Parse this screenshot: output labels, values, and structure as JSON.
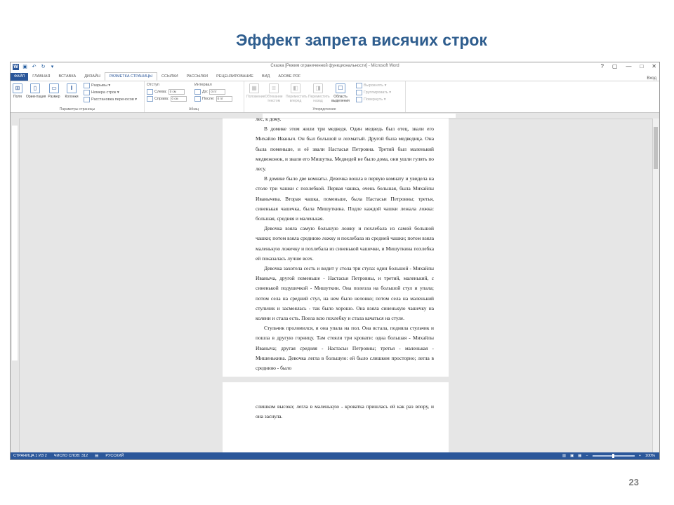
{
  "slide": {
    "title": "Эффект запрета висячих строк",
    "number": "23"
  },
  "window": {
    "doc_title": "Сказка [Режим ограниченной функциональности] - Microsoft Word",
    "help": "?",
    "restore": "▢",
    "minimize": "—",
    "maximize": "□",
    "close": "✕",
    "account": "Вход"
  },
  "tabs": [
    {
      "label": "ФАЙЛ"
    },
    {
      "label": "ГЛАВНАЯ"
    },
    {
      "label": "ВСТАВКА"
    },
    {
      "label": "ДИЗАЙН"
    },
    {
      "label": "РАЗМЕТКА СТРАНИЦЫ"
    },
    {
      "label": "ССЫЛКИ"
    },
    {
      "label": "РАССЫЛКИ"
    },
    {
      "label": "РЕЦЕНЗИРОВАНИЕ"
    },
    {
      "label": "ВИД"
    },
    {
      "label": "ADOBE PDF"
    }
  ],
  "ribbon": {
    "page_setup": {
      "group_name": "Параметры страницы",
      "fields": "Поля",
      "orientation": "Ориентация",
      "size": "Размер",
      "columns": "Колонки",
      "breaks": "Разрывы ▾",
      "line_numbers": "Номера строк ▾",
      "hyphenation": "Расстановка переносов ▾"
    },
    "paragraph": {
      "group_name": "Абзац",
      "indent": "Отступ",
      "indent_left_label": "Слева:",
      "indent_left_value": "0 см",
      "indent_right_label": "Справа:",
      "indent_right_value": "0 см",
      "spacing": "Интервал",
      "spacing_before_label": "До:",
      "spacing_before_value": "0 пт",
      "spacing_after_label": "После:",
      "spacing_after_value": "0 пт"
    },
    "arrange": {
      "group_name": "Упорядочение",
      "position": "Положение",
      "wrap_text": "Обтекание текстом",
      "bring_forward": "Переместить вперед",
      "send_backward": "Переместить назад",
      "selection_pane": "Область выделения",
      "align": "Выровнять ▾",
      "group": "Группировать ▾",
      "rotate": "Повернуть ▾"
    }
  },
  "document": {
    "page1_paragraphs": [
      {
        "text": "лес, к дому.",
        "cont": true
      },
      {
        "text": "В домике этом жили три медведя. Один медведь был отец, звали его Михайло Иваныч. Он был большой и лохматый. Другой была медведица. Она была поменьше, и её звали Настасья Петровна. Третий был маленький медвежонок, и звали его Мишутка. Медведей не было дома, они ушли гулять по лесу.",
        "cont": false
      },
      {
        "text": "В домике было две комнаты. Девочка вошла в первую комнату и увидела на столе три чашки с похлебкой. Первая чашка, очень большая, была Михайлы Иванычева. Вторая чашка, поменьше, была Настасьи Петровны; третья, синенькая чашечка, была Мишуткина. Подле каждой чашки лежала ложка: большая, средняя и маленькая.",
        "cont": false
      },
      {
        "text": "Девочка взяла самую большую ложку и похлебала из самой большой чашки; потом взяла среднюю ложку и похлебала из средней чашки; потом взяла маленькую ложечку и похлебала из синенькой чашечки, и Мишуткина похлебка ей показалась лучше всех.",
        "cont": false
      },
      {
        "text": "Девочка захотела сесть и видит у стола три стула: один большой - Михайлы Иваныча, другой поменьше - Настасьи Петровны, и третий, маленький, с синенькой подушечкой - Мишуткин. Она полезла на большой стул и упала; потом села на средний стул, на нем было неловко; потом села на маленький стульчик и засмеялась - так было хорошо. Она взяла синенькую чашечку на колени и стала есть. Поела всю похлебку и стала качаться на стуле.",
        "cont": false
      },
      {
        "text": "Стульчик проломился, и она упала на пол. Она встала, подняла стульчик и пошла в другую горницу. Там стояли три кровати: одна большая - Михайлы Иваныча; другая средняя - Настасьи Петровны; третья - маленькая - Мишенькина. Девочка легла в большую: ей было слишком просторно; легла в среднюю - было",
        "cont": false
      }
    ],
    "page2_paragraphs": [
      {
        "text": "слишком высоко; легла в маленькую - кроватка пришлась ей как раз впору, и она заснула.",
        "cont": true
      }
    ]
  },
  "statusbar": {
    "page": "СТРАНИЦА 1 ИЗ 2",
    "words": "ЧИСЛО СЛОВ: 312",
    "language": "РУССКИЙ",
    "zoom_minus": "−",
    "zoom_plus": "+",
    "zoom": "100%"
  }
}
